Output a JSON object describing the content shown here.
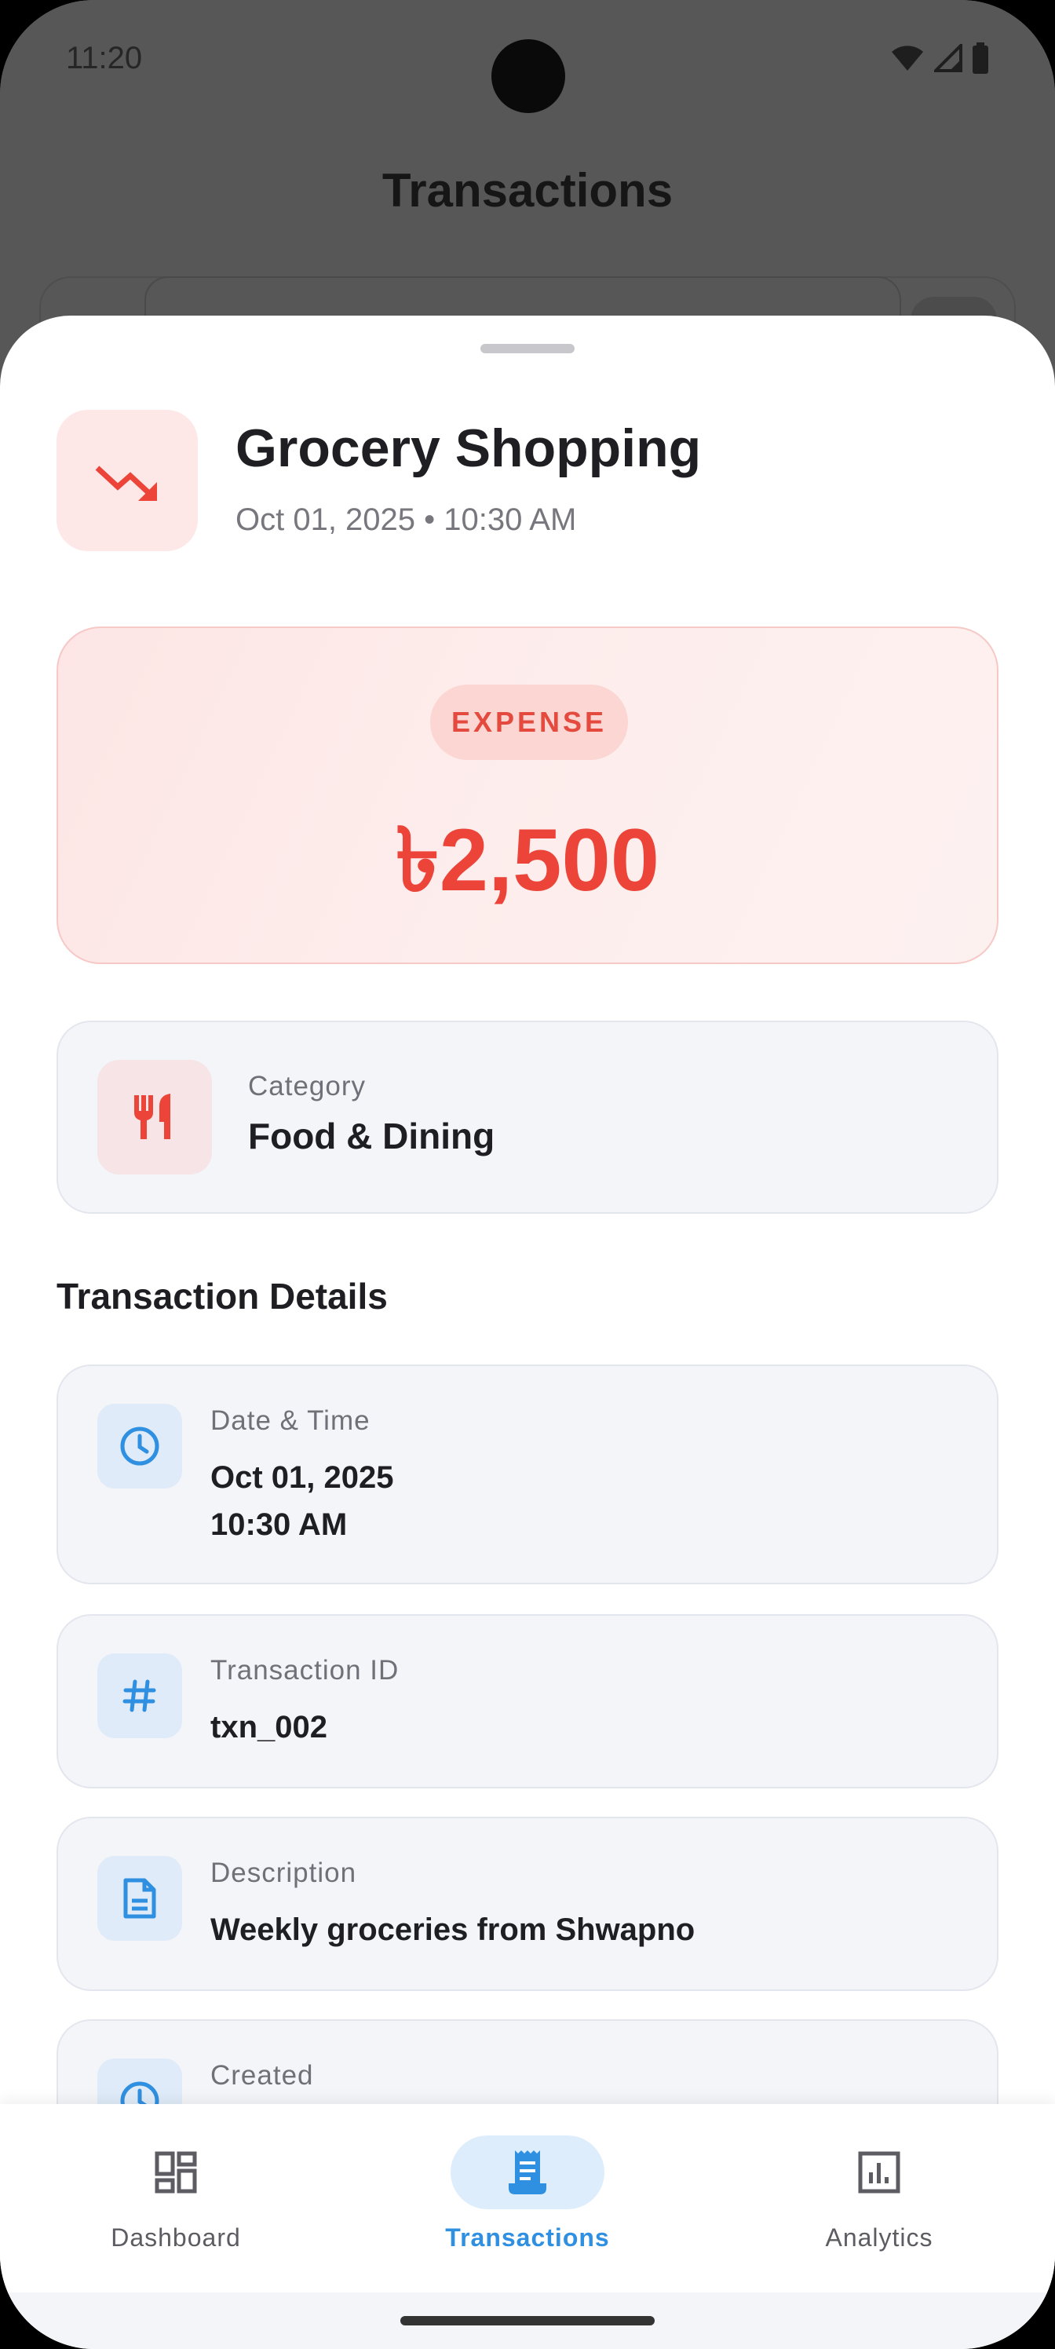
{
  "status_bar": {
    "time": "11:20"
  },
  "background_screen": {
    "title": "Transactions"
  },
  "transaction": {
    "title": "Grocery Shopping",
    "subtitle": "Oct 01, 2025 • 10:30 AM",
    "type_badge": "EXPENSE",
    "amount": "৳2,500",
    "category_label": "Category",
    "category_value": "Food & Dining"
  },
  "details": {
    "section_title": "Transaction Details",
    "items": [
      {
        "label": "Date & Time",
        "value_line1": "Oct 01, 2025",
        "value_line2": "10:30 AM",
        "icon": "clock-icon"
      },
      {
        "label": "Transaction ID",
        "value_line1": "txn_002",
        "icon": "hash-icon"
      },
      {
        "label": "Description",
        "value_line1": "Weekly groceries from Shwapno",
        "icon": "document-icon"
      },
      {
        "label": "Created",
        "icon": "clock-icon"
      }
    ]
  },
  "bottom_nav": {
    "items": [
      {
        "label": "Dashboard",
        "icon": "dashboard-icon",
        "active": false
      },
      {
        "label": "Transactions",
        "icon": "receipt-icon",
        "active": true
      },
      {
        "label": "Analytics",
        "icon": "analytics-icon",
        "active": false
      }
    ]
  },
  "colors": {
    "expense_red": "#ec4439",
    "accent_blue": "#2f8fe0",
    "card_bg": "#f4f5f9"
  }
}
